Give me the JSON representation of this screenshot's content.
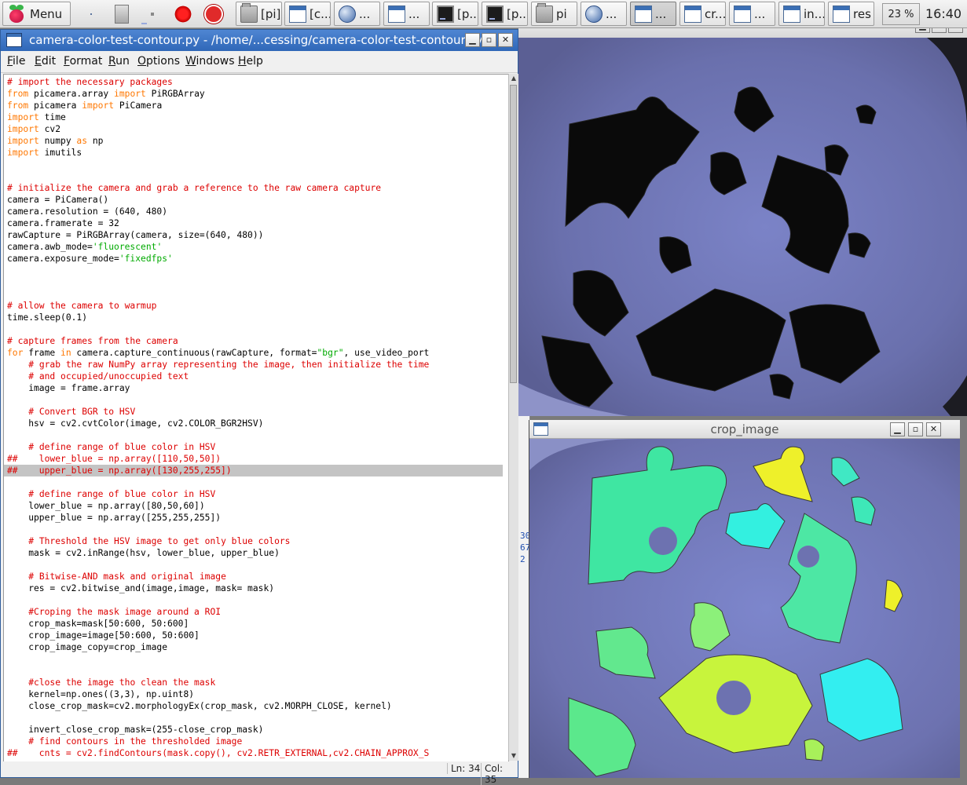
{
  "taskbar": {
    "menu_label": "Menu",
    "items": [
      {
        "label": "[pi]",
        "icon": "folder-icon"
      },
      {
        "label": "[c...",
        "icon": "window-icon"
      },
      {
        "label": "...",
        "icon": "globe-icon"
      },
      {
        "label": "...",
        "icon": "window-icon"
      },
      {
        "label": "[p...",
        "icon": "terminal-icon"
      },
      {
        "label": "[p...",
        "icon": "terminal-icon"
      },
      {
        "label": "pi",
        "icon": "folder-icon"
      },
      {
        "label": "...",
        "icon": "globe-icon"
      },
      {
        "label": "...",
        "icon": "window-icon"
      },
      {
        "label": "cr...",
        "icon": "window-icon"
      },
      {
        "label": "...",
        "icon": "window-icon"
      },
      {
        "label": "in...",
        "icon": "window-icon"
      },
      {
        "label": "res",
        "icon": "window-icon"
      }
    ],
    "cpu": "23 %",
    "clock": "16:40"
  },
  "editor": {
    "title": "camera-color-test-contour.py - /home/...cessing/camera-color-test-contour.py",
    "menus": [
      "File",
      "Edit",
      "Format",
      "Run",
      "Options",
      "Windows",
      "Help"
    ],
    "code": [
      "# import the necessary packages",
      "from picamera.array import PiRGBArray",
      "from picamera import PiCamera",
      "import time",
      "import cv2",
      "import numpy as np",
      "import imutils",
      "",
      "",
      "# initialize the camera and grab a reference to the raw camera capture",
      "camera = PiCamera()",
      "camera.resolution = (640, 480)",
      "camera.framerate = 32",
      "rawCapture = PiRGBArray(camera, size=(640, 480))",
      "camera.awb_mode='fluorescent'",
      "camera.exposure_mode='fixedfps'",
      "",
      "",
      "",
      "# allow the camera to warmup",
      "time.sleep(0.1)",
      "",
      "# capture frames from the camera",
      "for frame in camera.capture_continuous(rawCapture, format=\"bgr\", use_video_port",
      "    # grab the raw NumPy array representing the image, then initialize the time",
      "    # and occupied/unoccupied text",
      "    image = frame.array",
      "",
      "    # Convert BGR to HSV",
      "    hsv = cv2.cvtColor(image, cv2.COLOR_BGR2HSV)",
      "",
      "    # define range of blue color in HSV",
      "##    lower_blue = np.array([110,50,50])",
      "##    upper_blue = np.array([130,255,255])",
      "",
      "    # define range of blue color in HSV",
      "    lower_blue = np.array([80,50,60])",
      "    upper_blue = np.array([255,255,255])",
      "",
      "    # Threshold the HSV image to get only blue colors",
      "    mask = cv2.inRange(hsv, lower_blue, upper_blue)",
      "",
      "    # Bitwise-AND mask and original image",
      "    res = cv2.bitwise_and(image,image, mask= mask)",
      "",
      "    #Croping the mask image around a ROI",
      "    crop_mask=mask[50:600, 50:600]",
      "    crop_image=image[50:600, 50:600]",
      "    crop_image_copy=crop_image",
      "",
      "",
      "    #close the image tho clean the mask",
      "    kernel=np.ones((3,3), np.uint8)",
      "    close_crop_mask=cv2.morphologyEx(crop_mask, cv2.MORPH_CLOSE, kernel)",
      "",
      "    invert_close_crop_mask=(255-close_crop_mask)",
      "    # find contours in the thresholded image",
      "##    cnts = cv2.findContours(mask.copy(), cv2.RETR_EXTERNAL,cv2.CHAIN_APPROX_S"
    ],
    "highlight_line": 33,
    "status_ln": "Ln: 34",
    "status_col": "Col: 35"
  },
  "res_window": {
    "title": "res"
  },
  "crop_window": {
    "title": "crop_image"
  },
  "bg_window_fragments": [
    "30",
    "67",
    "2"
  ],
  "colors": {
    "titlebar_active": "#2f67b8",
    "res_background": "#7076ad",
    "crop_background": "#6e74ae",
    "keyword": "#ff7700",
    "comment": "#dd0000",
    "string": "#00aa00"
  }
}
